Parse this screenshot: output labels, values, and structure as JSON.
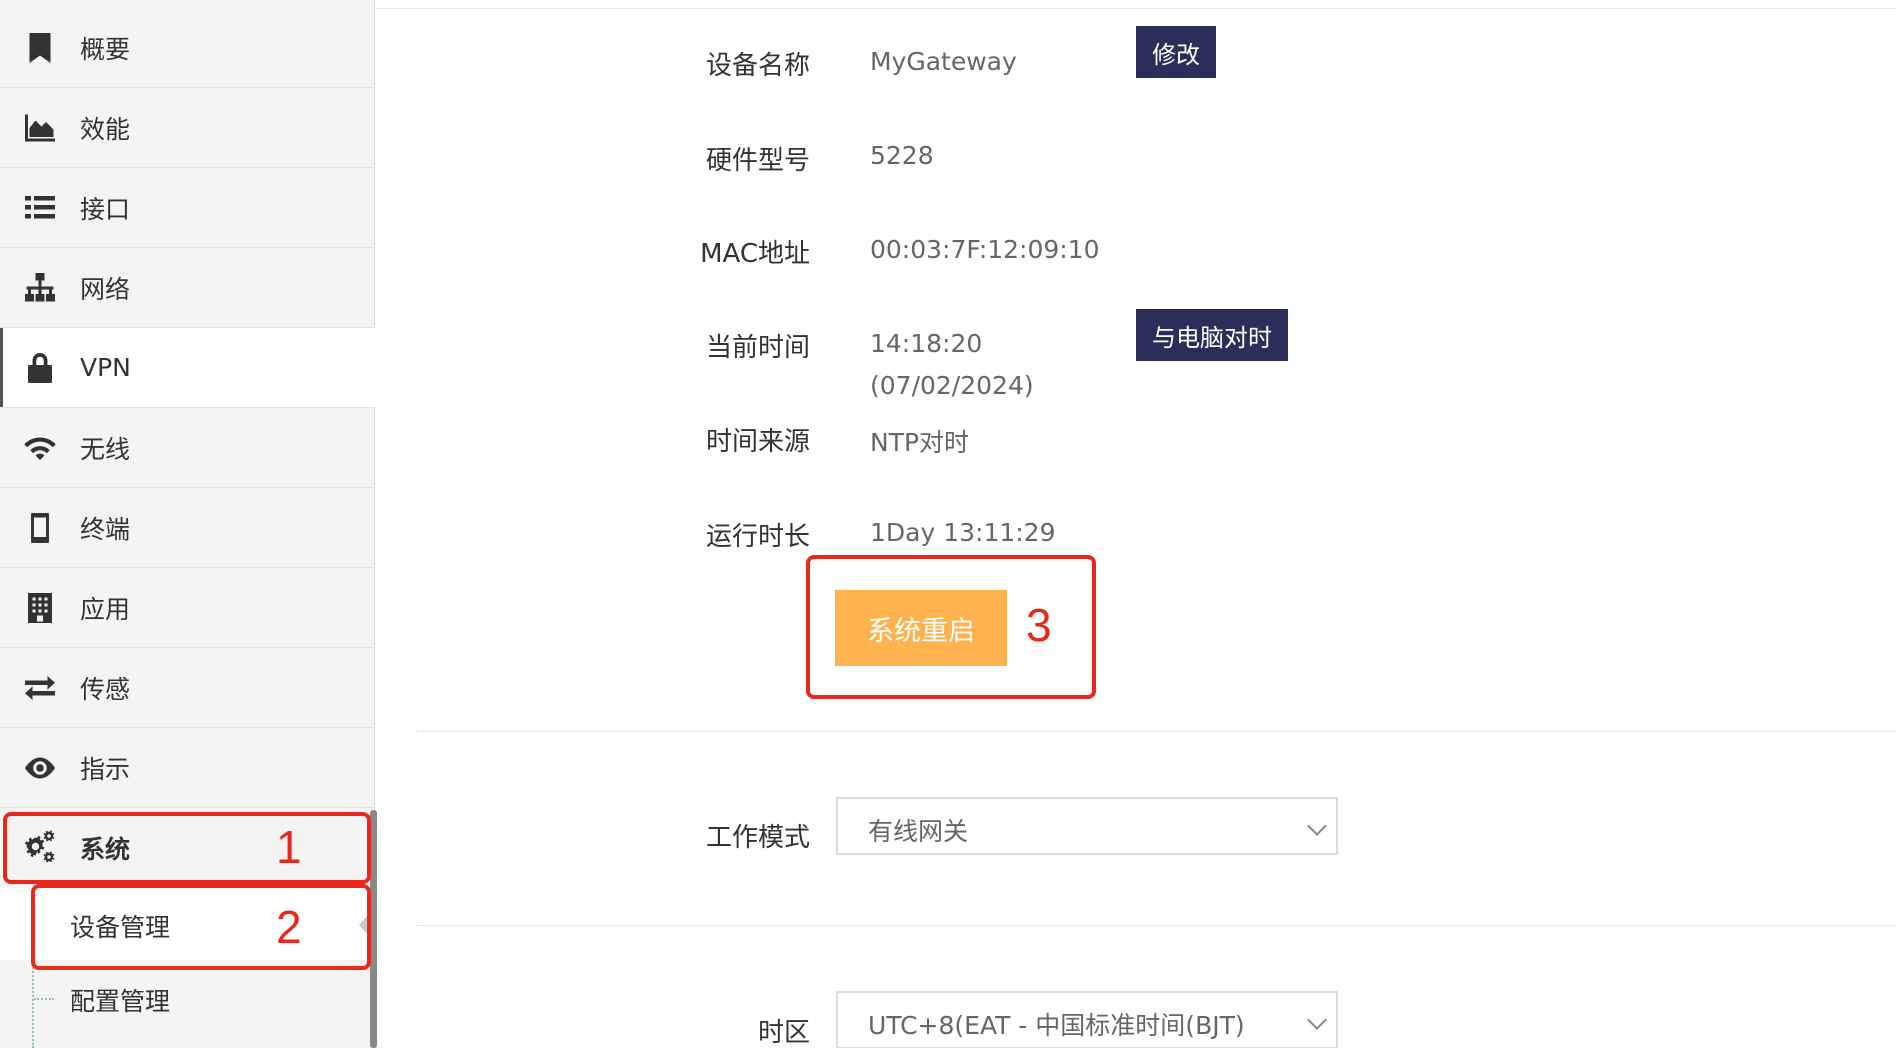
{
  "sidebar": {
    "items": [
      {
        "label": "概要",
        "icon": "bookmark-icon"
      },
      {
        "label": "效能",
        "icon": "area-chart-icon"
      },
      {
        "label": "接口",
        "icon": "list-icon"
      },
      {
        "label": "网络",
        "icon": "sitemap-icon"
      },
      {
        "label": "VPN",
        "icon": "lock-icon"
      },
      {
        "label": "无线",
        "icon": "wifi-icon"
      },
      {
        "label": "终端",
        "icon": "mobile-icon"
      },
      {
        "label": "应用",
        "icon": "building-icon"
      },
      {
        "label": "传感",
        "icon": "exchange-icon"
      },
      {
        "label": "指示",
        "icon": "eye-icon"
      },
      {
        "label": "系统",
        "icon": "gears-icon"
      }
    ],
    "sub_items": [
      {
        "label": "设备管理"
      },
      {
        "label": "配置管理"
      }
    ]
  },
  "device": {
    "name_label": "设备名称",
    "name_value": "MyGateway",
    "edit_button": "修改",
    "model_label": "硬件型号",
    "model_value": "5228",
    "mac_label": "MAC地址",
    "mac_value": "00:03:7F:12:09:10",
    "time_label": "当前时间",
    "time_value": "14:18:20",
    "date_value": "(07/02/2024)",
    "sync_button": "与电脑对时",
    "source_label": "时间来源",
    "source_value": "NTP对时",
    "uptime_label": "运行时长",
    "uptime_value": "1Day 13:11:29",
    "reboot_button": "系统重启"
  },
  "work_mode": {
    "label": "工作模式",
    "selected": "有线网关"
  },
  "timezone": {
    "label": "时区",
    "selected": "UTC+8(EAT - 中国标准时间(BJT)"
  },
  "annotations": [
    "1",
    "2",
    "3"
  ],
  "colors": {
    "dark_button": "#2b2d5b",
    "reboot_button": "#ffb24d",
    "annotation": "#e8281a"
  }
}
